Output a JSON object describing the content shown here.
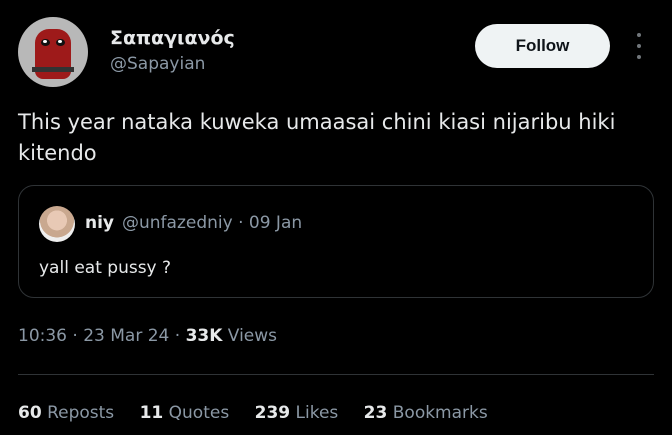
{
  "author": {
    "display_name": "Σαπαγιανός",
    "handle": "@Sapayian",
    "follow_label": "Follow"
  },
  "tweet": {
    "text": "This year nataka kuweka umaasai chini kiasi nijaribu hiki kitendo"
  },
  "quoted": {
    "name": "niy",
    "handle_date": "@unfazedniy · 09 Jan",
    "text": "yall eat pussy ?"
  },
  "meta": {
    "time_date": "10:36 · 23 Mar 24 · ",
    "views_count": "33K",
    "views_label": " Views"
  },
  "stats": {
    "reposts": "60",
    "reposts_label": "Reposts",
    "quotes": "11",
    "quotes_label": "Quotes",
    "likes": "239",
    "likes_label": "Likes",
    "bookmarks": "23",
    "bookmarks_label": "Bookmarks"
  },
  "icons": {
    "more": "more-dots-icon"
  },
  "colors": {
    "background": "#000000",
    "secondary_text": "#8b98a5",
    "follow_bg": "#eff3f4"
  }
}
